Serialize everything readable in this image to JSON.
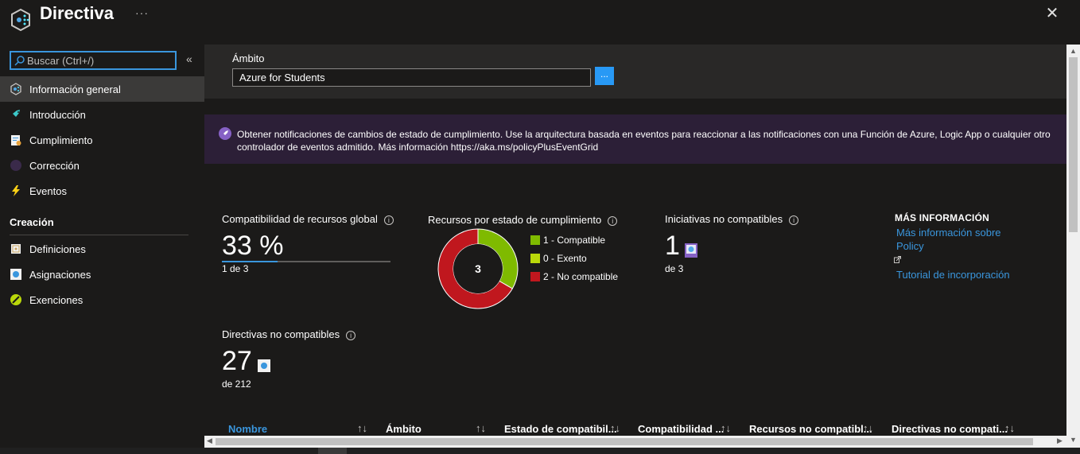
{
  "header": {
    "title": "Directiva",
    "more_label": "···",
    "close_label": "✕"
  },
  "sidebar": {
    "search_placeholder": "Buscar (Ctrl+/)",
    "collapse_label": "«",
    "items": [
      {
        "label": "Información general",
        "icon": "overview-icon",
        "active": true
      },
      {
        "label": "Introducción",
        "icon": "getting-started-icon"
      },
      {
        "label": "Cumplimiento",
        "icon": "compliance-icon"
      },
      {
        "label": "Corrección",
        "icon": "remediation-icon"
      },
      {
        "label": "Eventos",
        "icon": "events-icon"
      }
    ],
    "section_title": "Creación",
    "authoring_items": [
      {
        "label": "Definiciones",
        "icon": "definitions-icon"
      },
      {
        "label": "Asignaciones",
        "icon": "assignments-icon"
      },
      {
        "label": "Exenciones",
        "icon": "exemptions-icon"
      }
    ]
  },
  "scope": {
    "label": "Ámbito",
    "value": "Azure for Students",
    "button_label": "..."
  },
  "banner": {
    "text": "Obtener notificaciones de cambios de estado de cumplimiento. Use la arquitectura basada en eventos para reaccionar a las notificaciones con una Función de Azure, Logic App o cualquier otro controlador de eventos admitido. Más información https://aka.ms/policyPlusEventGrid"
  },
  "tiles": {
    "resource_compliance": {
      "title": "Compatibilidad de recursos global",
      "value": "33 %",
      "fraction": 0.33,
      "sub": "1 de 3"
    },
    "resources_by_state": {
      "title": "Recursos por estado de cumplimiento",
      "center_label": "3",
      "legend": [
        {
          "label": "1 - Compatible",
          "color": "#7fba00",
          "count": 1
        },
        {
          "label": "0 - Exento",
          "color": "#bad80a",
          "count": 0
        },
        {
          "label": "2 - No compatible",
          "color": "#c0171e",
          "count": 2
        }
      ]
    },
    "noncompliant_initiatives": {
      "title": "Iniciativas no compatibles",
      "value": "1",
      "sub": "de 3"
    },
    "noncompliant_policies": {
      "title": "Directivas no compatibles",
      "value": "27",
      "sub": "de 212"
    },
    "more_info": {
      "heading": "MÁS INFORMACIÓN",
      "link1_line1": "Más información sobre",
      "link1_line2": "Policy",
      "link2": "Tutorial de incorporación"
    }
  },
  "table": {
    "columns": [
      "Nombre",
      "Ámbito",
      "Estado de compatibil...",
      "Compatibilidad ...",
      "Recursos no compatibl...",
      "Directivas no compati..."
    ],
    "sort_glyph": "↑↓"
  },
  "colors": {
    "accent": "#3a96dd",
    "compliant": "#7fba00",
    "exempt": "#bad80a",
    "noncompliant": "#c0171e",
    "banner_bg": "#2c1f37"
  }
}
